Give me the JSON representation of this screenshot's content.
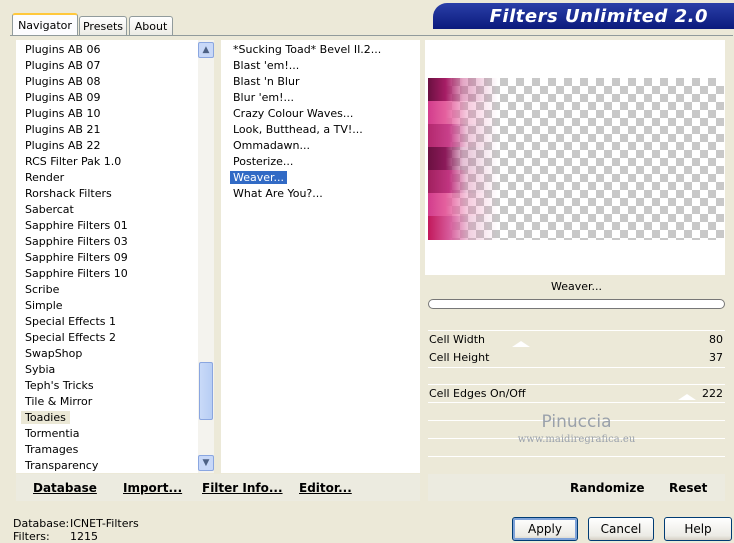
{
  "banner": {
    "title": "Filters Unlimited 2.0"
  },
  "tabs": [
    {
      "label": "Navigator",
      "active": true
    },
    {
      "label": "Presets",
      "active": false
    },
    {
      "label": "About",
      "active": false
    }
  ],
  "categories": {
    "items": [
      "Plugins AB 06",
      "Plugins AB 07",
      "Plugins AB 08",
      "Plugins AB 09",
      "Plugins AB 10",
      "Plugins AB 21",
      "Plugins AB 22",
      "RCS Filter Pak 1.0",
      "Render",
      "Rorshack Filters",
      "Sabercat",
      "Sapphire Filters 01",
      "Sapphire Filters 03",
      "Sapphire Filters 09",
      "Sapphire Filters 10",
      "Scribe",
      "Simple",
      "Special Effects 1",
      "Special Effects 2",
      "SwapShop",
      "Sybia",
      "Teph's Tricks",
      "Tile & Mirror",
      "Toadies",
      "Tormentia",
      "Tramages",
      "Transparency"
    ],
    "selected": "Toadies"
  },
  "filters": {
    "items": [
      "*Sucking Toad*  Bevel II.2...",
      "Blast 'em!...",
      "Blast 'n Blur",
      "Blur 'em!...",
      "Crazy Colour Waves...",
      "Look, Butthead, a TV!...",
      "Ommadawn...",
      "Posterize...",
      "Weaver...",
      "What Are You?..."
    ],
    "selected": "Weaver..."
  },
  "filter_name": "Weaver...",
  "params": [
    {
      "label": "Cell Width",
      "value": "80"
    },
    {
      "label": "Cell Height",
      "value": "37"
    },
    {
      "label": "Cell Edges On/Off",
      "value": "222"
    }
  ],
  "watermark": {
    "line1": "Pinuccia",
    "line2": "www.maidiregrafica.eu"
  },
  "left_buttons": {
    "database": "Database",
    "import": "Import...",
    "filter_info": "Filter Info...",
    "editor": "Editor..."
  },
  "right_buttons": {
    "randomize": "Randomize",
    "reset": "Reset"
  },
  "status": {
    "database_label": "Database:",
    "database_value": "ICNET-Filters",
    "filters_label": "Filters:",
    "filters_value": "1215"
  },
  "dialog_buttons": {
    "apply": "Apply",
    "cancel": "Cancel",
    "help": "Help"
  },
  "colors": {
    "banner": "#0b1a7c",
    "selection": "#316ac5",
    "preview_pink": "#c2185b"
  }
}
